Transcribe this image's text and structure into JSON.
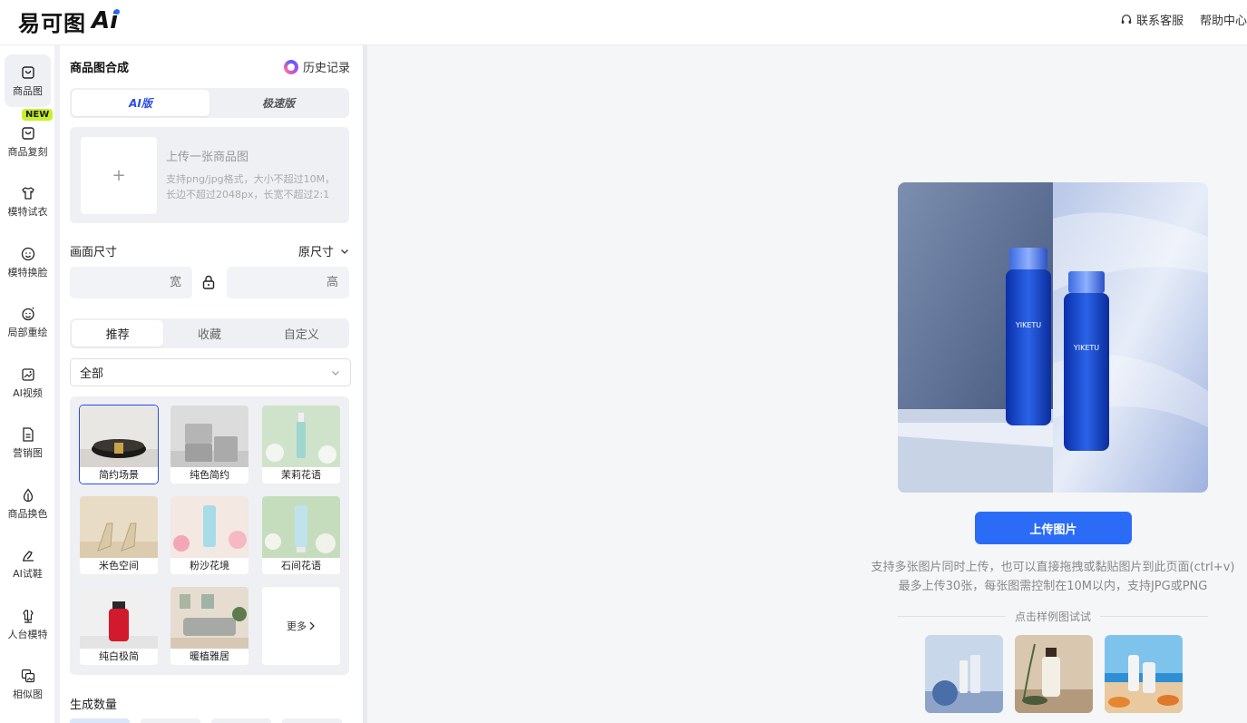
{
  "header": {
    "logo_text": "易可图",
    "logo_ai": "Ai",
    "contact": "联系客服",
    "help": "帮助中心"
  },
  "nav": {
    "new_badge": "NEW",
    "items": [
      {
        "label": "商品图",
        "icon": "bag-icon"
      },
      {
        "label": "商品复刻",
        "icon": "copy-bag-icon"
      },
      {
        "label": "模特试衣",
        "icon": "shirt-icon"
      },
      {
        "label": "模特换脸",
        "icon": "face-icon"
      },
      {
        "label": "局部重绘",
        "icon": "repaint-icon"
      },
      {
        "label": "AI视频",
        "icon": "video-icon"
      },
      {
        "label": "营销图",
        "icon": "poster-icon"
      },
      {
        "label": "商品换色",
        "icon": "color-drop-icon"
      },
      {
        "label": "AI试鞋",
        "icon": "shoe-icon"
      },
      {
        "label": "人台模特",
        "icon": "mannequin-icon"
      },
      {
        "label": "相似图",
        "icon": "similar-image-icon"
      }
    ]
  },
  "panel": {
    "title": "商品图合成",
    "history": "历史记录",
    "mode_tabs": [
      "AI版",
      "极速版"
    ],
    "upload": {
      "plus": "+",
      "title": "上传一张商品图",
      "desc": "支持png/jpg格式，大小不超过10M，长边不超过2048px，长宽不超过2:1"
    },
    "size": {
      "label": "画面尺寸",
      "value": "原尺寸",
      "width_placeholder": "宽",
      "height_placeholder": "高"
    },
    "scene_tabs": [
      "推荐",
      "收藏",
      "自定义"
    ],
    "filter": "全部",
    "templates": [
      "简约场景",
      "纯色简约",
      "茉莉花语",
      "米色空间",
      "粉沙花境",
      "石间花语",
      "纯白极简",
      "暖植雅居"
    ],
    "more": "更多",
    "count_label": "生成数量"
  },
  "main": {
    "upload_button": "上传图片",
    "hint": "支持多张图片同时上传，也可以直接拖拽或黏贴图片到此页面(ctrl+v) 最多上传30张，每张图需控制在10M以内，支持JPG或PNG",
    "samples_label": "点击样例图试试",
    "hero_brand": "YIKETU"
  },
  "colors": {
    "accent": "#2b6cf6",
    "tab_active": "#2c4be8",
    "badge": "#c6f02a"
  }
}
